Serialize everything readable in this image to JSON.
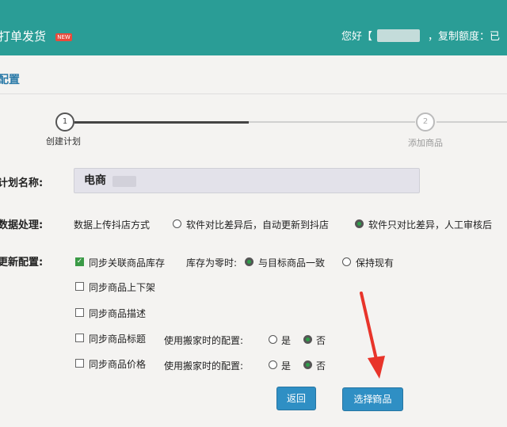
{
  "header": {
    "title": "打单发货",
    "badge": "NEW",
    "greeting": "您好【",
    "quota": "，复制额度：已"
  },
  "section": {
    "title": "配置"
  },
  "steps": [
    {
      "number": "1",
      "label": "创建计划",
      "active": true
    },
    {
      "number": "2",
      "label": "添加商品",
      "active": false
    }
  ],
  "form": {
    "plan_name": {
      "label": "计划名称:",
      "value": "电商"
    },
    "data_processing": {
      "label": "数据处理:",
      "text": "数据上传抖店方式",
      "options": [
        {
          "label": "软件对比差异后，自动更新到抖店",
          "selected": false
        },
        {
          "label": "软件只对比差异，人工审核后",
          "selected": true
        }
      ]
    },
    "update_config": {
      "label": "更新配置:",
      "sync_stock": {
        "label": "同步关联商品库存",
        "checked": true,
        "zero_label": "库存为零时:",
        "options": [
          {
            "label": "与目标商品一致",
            "selected": true
          },
          {
            "label": "保持现有",
            "selected": false
          }
        ]
      },
      "sync_shelf": {
        "label": "同步商品上下架",
        "checked": false
      },
      "sync_desc": {
        "label": "同步商品描述",
        "checked": false
      },
      "sync_title": {
        "label": "同步商品标题",
        "checked": false,
        "config_label": "使用搬家时的配置:",
        "options": [
          {
            "label": "是",
            "selected": false
          },
          {
            "label": "否",
            "selected": true
          }
        ]
      },
      "sync_price": {
        "label": "同步商品价格",
        "checked": false,
        "config_label": "使用搬家时的配置:",
        "options": [
          {
            "label": "是",
            "selected": false
          },
          {
            "label": "否",
            "selected": true
          }
        ]
      }
    }
  },
  "buttons": {
    "back": "返回",
    "select_products": "选择商品"
  },
  "colors": {
    "header": "#2a9d96",
    "accent_button": "#2f8fc4",
    "radio_selected": "#2e9e4a",
    "arrow": "#e8342a"
  }
}
